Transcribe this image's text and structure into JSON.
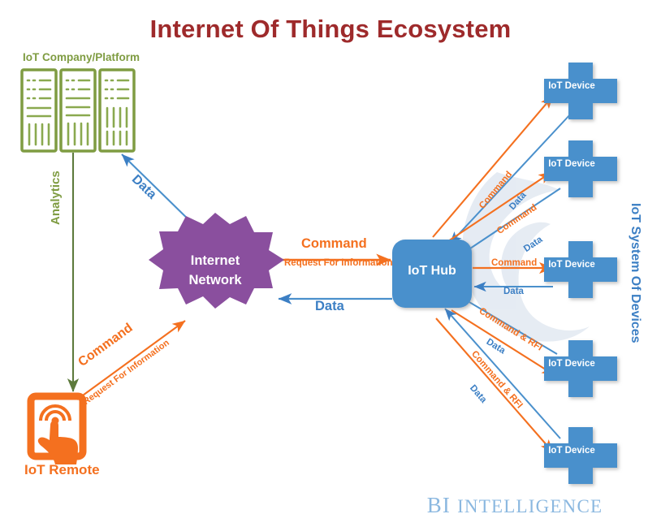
{
  "title": "Internet Of Things Ecosystem",
  "brand": {
    "prefix": "BI",
    "name": "INTELLIGENCE"
  },
  "colors": {
    "title": "#9e2a2b",
    "command": "#f4701f",
    "data": "#3c7fc4",
    "network": "#8a4f9e",
    "hub": "#4a90cc",
    "device": "#4a90cc",
    "server": "#7f9c42",
    "remote": "#f4701f",
    "brand": "#8bb8e0",
    "watermark": "#dde5ef"
  },
  "nodes": {
    "platform": {
      "label": "IoT Company/Platform",
      "icon": "server-rack-icon",
      "count": 3
    },
    "remote": {
      "label": "IoT Remote",
      "icon": "mobile-touch-icon"
    },
    "network": {
      "label_line1": "Internet",
      "label_line2": "Internet Network",
      "label": "Internet\nNetwork"
    },
    "hub": {
      "label": "IoT Hub"
    },
    "devices_axis_label": "IoT System Of Devices",
    "devices": [
      {
        "label": "IoT Device"
      },
      {
        "label": "IoT Device"
      },
      {
        "label": "IoT Device"
      },
      {
        "label": "IoT Device"
      },
      {
        "label": "IoT Device"
      }
    ]
  },
  "edge_labels": {
    "analytics": "Analytics",
    "data_to_platform": "Data",
    "remote_command": "Command",
    "remote_rfi": "Request For Information",
    "net_hub_command": "Command",
    "net_hub_rfi": "Request For Information",
    "hub_net_data": "Data",
    "dev1_command": "Command",
    "dev1_data": "Data",
    "dev2_command": "Command",
    "dev2_data": "Data",
    "dev3_command": "Command",
    "dev3_data": "Data",
    "dev4_command": "Command & RFI",
    "dev4_data": "Data",
    "dev5_command": "Command & RFI",
    "dev5_data": "Data"
  }
}
